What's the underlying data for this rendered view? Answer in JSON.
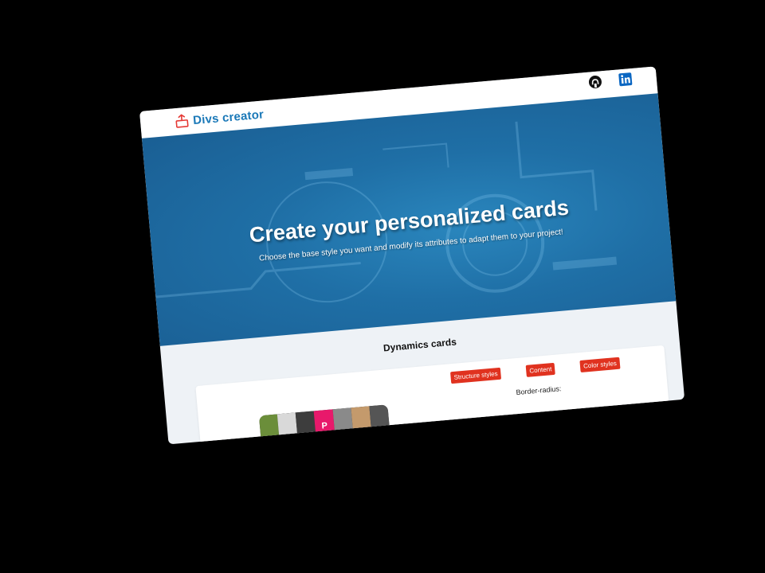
{
  "header": {
    "brand_name": "Divs creator",
    "logo_icon": "monitor-logo-icon",
    "github_icon": "github-icon",
    "linkedin_icon": "linkedin-icon"
  },
  "hero": {
    "title": "Create your personalized cards",
    "subtitle": "Choose the base style you want and modify its attributes to adapt them to your project!"
  },
  "section": {
    "title": "Dynamics cards"
  },
  "editor": {
    "tabs": [
      {
        "label": "Structure styles"
      },
      {
        "label": "Content"
      },
      {
        "label": "Color styles"
      }
    ],
    "border_radius_label": "Border-radius:"
  },
  "colors": {
    "brand": "#1b79b8",
    "accent_button": "#e0321f",
    "hero_blue": "#1f6fa6"
  }
}
